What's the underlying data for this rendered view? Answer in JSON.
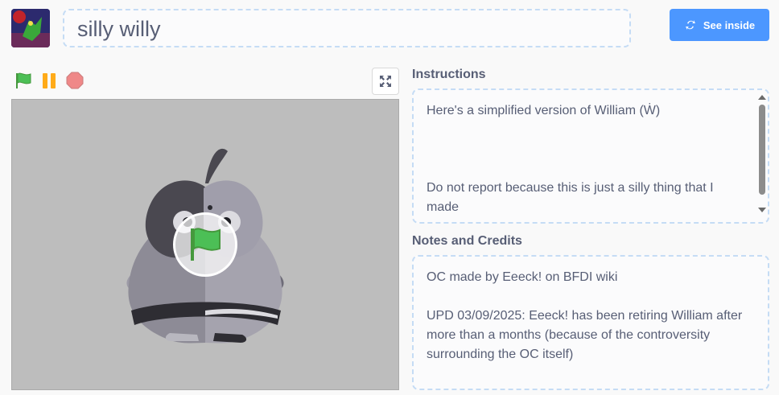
{
  "project": {
    "title": "silly willy",
    "see_inside_label": "See inside"
  },
  "controls": {
    "green_flag": "green-flag-icon",
    "pause": "pause-icon",
    "stop": "stop-icon",
    "fullscreen": "fullscreen-icon"
  },
  "instructions": {
    "heading": "Instructions",
    "line1": "Here's a simplified version of William (Ẇ)",
    "line2": "Do not report because this is just a silly thing that I",
    "line3": "made"
  },
  "notes": {
    "heading": "Notes and Credits",
    "line1": "OC made by Eeeck! on BFDI wiki",
    "line2": "UPD 03/09/2025: Eeeck! has been retiring William after",
    "line3": "more than a months (because of the controversity",
    "line4": "surrounding the OC itself)"
  },
  "colors": {
    "accent": "#4c97ff",
    "flag_green": "#4cbf56",
    "pause_orange": "#ffab19",
    "stop_red": "#ec5959"
  }
}
